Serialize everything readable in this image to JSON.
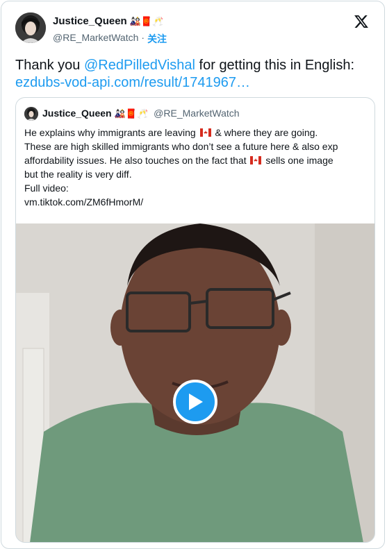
{
  "author": {
    "name": "Justice_Queen",
    "name_emojis": "🎎🧧🥂",
    "handle": "@RE_MarketWatch",
    "separator": "·",
    "follow_label": "关注"
  },
  "tweet": {
    "prefix": "Thank you ",
    "mention": "@RedPilledVishal",
    "suffix": " for getting this in English:",
    "link": "ezdubs-vod-api.com/result/1741967…"
  },
  "quoted": {
    "name": "Justice_Queen",
    "name_emojis": "🎎🧧🥂",
    "handle": "@RE_MarketWatch",
    "line1_a": "He explains why immigrants are leaving",
    "line1_b": "& where they are going.",
    "line2": "These are high skilled immigrants who don’t see a future here & also exp",
    "line3_a": "affordability issues. He also touches on the fact that",
    "line3_b": "sells one image",
    "line4": "but the reality is very diff.",
    "line5": "Full video:",
    "line6": "vm.tiktok.com/ZM6fHmorM/"
  },
  "icons": {
    "x_logo": "x-logo-icon",
    "play": "play-icon",
    "flag": "canada-flag-icon"
  },
  "colors": {
    "accent": "#1d9bf0",
    "text": "#0f1419",
    "secondary": "#536471",
    "border": "#cfd9de"
  }
}
